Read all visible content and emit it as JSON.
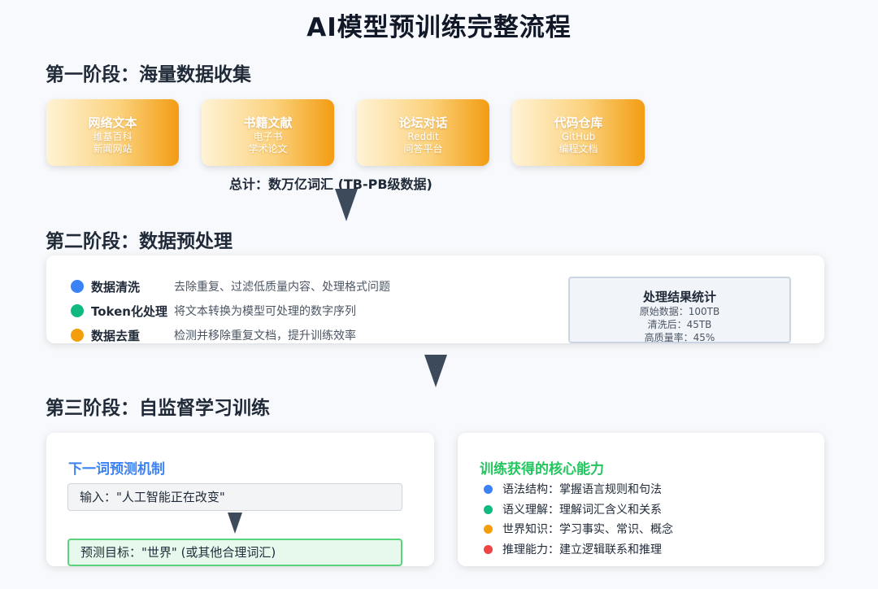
{
  "title": "AI模型预训练完整流程",
  "stage1": {
    "title": "第一阶段：海量数据收集",
    "sources": [
      {
        "name": "网络文本",
        "lines": [
          "维基百科",
          "新闻网站"
        ]
      },
      {
        "name": "书籍文献",
        "lines": [
          "电子书",
          "学术论文"
        ]
      },
      {
        "name": "论坛对话",
        "lines": [
          "Reddit",
          "问答平台"
        ]
      },
      {
        "name": "代码仓库",
        "lines": [
          "GitHub",
          "编程文档"
        ]
      }
    ],
    "total": "总计：数万亿词汇 (TB-PB级数据)"
  },
  "stage2": {
    "title": "第二阶段：数据预处理",
    "steps": [
      {
        "name": "数据清洗",
        "desc": "去除重复、过滤低质量内容、处理格式问题",
        "color": "#3b82f6"
      },
      {
        "name": "Token化处理",
        "desc": "将文本转换为模型可处理的数字序列",
        "color": "#10b981"
      },
      {
        "name": "数据去重",
        "desc": "检测并移除重复文档，提升训练效率",
        "color": "#f59e0b"
      }
    ],
    "stats": {
      "title": "处理结果统计",
      "lines": [
        "原始数据：100TB",
        "清洗后：45TB",
        "高质量率：45%"
      ]
    }
  },
  "stage3": {
    "title": "第三阶段：自监督学习训练",
    "prediction": {
      "title": "下一词预测机制",
      "title_color": "#3b82f6",
      "input": "输入：\"人工智能正在改变\"",
      "target": "预测目标：\"世界\" (或其他合理词汇)"
    },
    "capabilities": {
      "title": "训练获得的核心能力",
      "title_color": "#22c55e",
      "items": [
        {
          "text": "语法结构：掌握语言规则和句法",
          "color": "#3b82f6"
        },
        {
          "text": "语义理解：理解词汇含义和关系",
          "color": "#10b981"
        },
        {
          "text": "世界知识：学习事实、常识、概念",
          "color": "#f59e0b"
        },
        {
          "text": "推理能力：建立逻辑联系和推理",
          "color": "#ef4444"
        }
      ]
    }
  },
  "colors": {
    "arrow": "#3d4a5c",
    "card_gradient_end": "#f39c12"
  }
}
